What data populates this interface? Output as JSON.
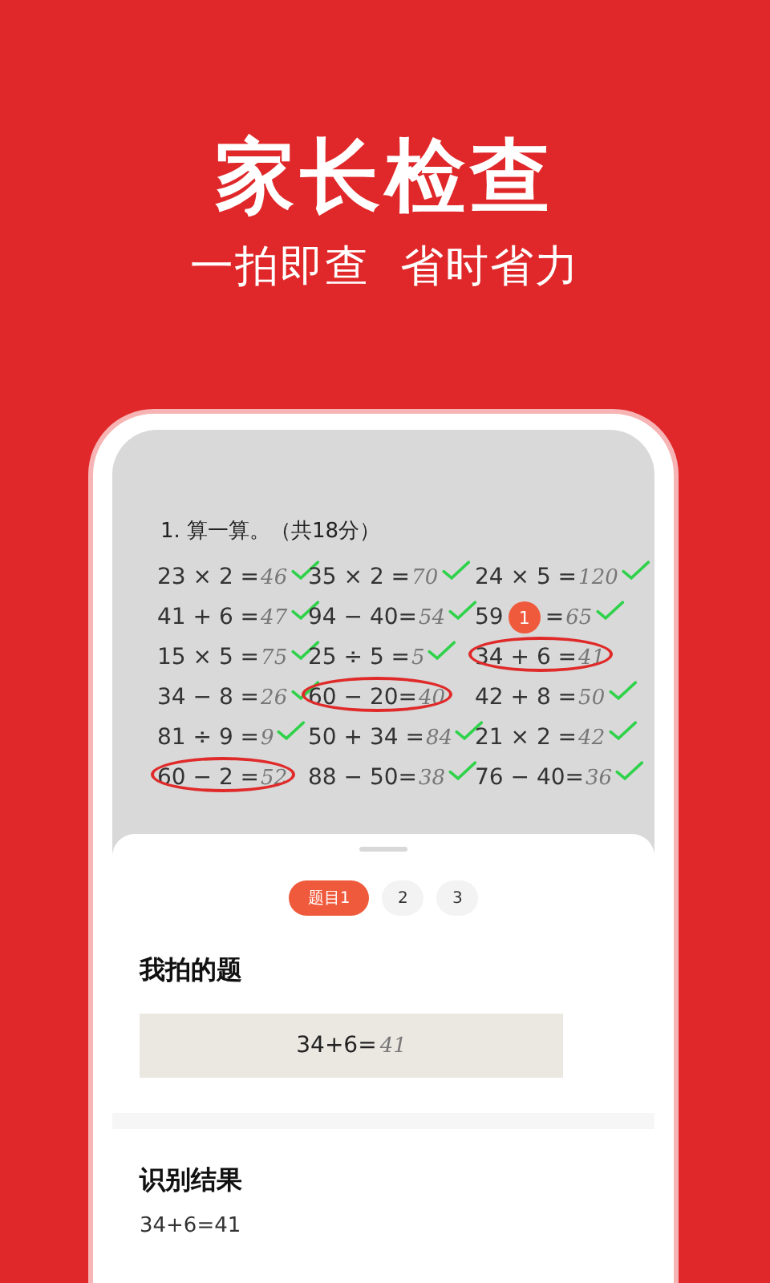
{
  "headline": "家长检查",
  "tagline": "一拍即查  省时省力",
  "worksheet": {
    "title": "1. 算一算。（共18分）",
    "items": [
      {
        "expr": "23 × 2 =",
        "answer": "46",
        "correct": true
      },
      {
        "expr": "35 × 2 =",
        "answer": "70",
        "correct": true
      },
      {
        "expr": "24 × 5 =",
        "answer": "120",
        "correct": true
      },
      {
        "expr": "41 + 6 =",
        "answer": "47",
        "correct": true
      },
      {
        "expr": "94 − 40=",
        "answer": "54",
        "correct": true
      },
      {
        "expr": "59",
        "expr_after": "=",
        "marker": "1",
        "answer": "65",
        "correct": true
      },
      {
        "expr": "15 × 5 =",
        "answer": "75",
        "correct": true
      },
      {
        "expr": "25 ÷ 5 =",
        "answer": "5",
        "correct": true
      },
      {
        "expr": "34 + 6 =",
        "answer": "41",
        "correct": false
      },
      {
        "expr": "34 − 8 =",
        "answer": "26",
        "correct": true
      },
      {
        "expr": "60 − 20=",
        "answer": "40",
        "correct": false
      },
      {
        "expr": "42 + 8 =",
        "answer": "50",
        "correct": true
      },
      {
        "expr": "81 ÷ 9 =",
        "answer": "9",
        "correct": true
      },
      {
        "expr": "50 + 34 =",
        "answer": "84",
        "correct": true
      },
      {
        "expr": "21 × 2 =",
        "answer": "42",
        "correct": true
      },
      {
        "expr": "60 − 2 =",
        "answer": "52",
        "correct": false
      },
      {
        "expr": "88 − 50=",
        "answer": "38",
        "correct": true
      },
      {
        "expr": "76 − 40=",
        "answer": "36",
        "correct": true
      }
    ]
  },
  "question_tabs": [
    {
      "label": "题目1",
      "selected": true
    },
    {
      "label": "2",
      "selected": false
    },
    {
      "label": "3",
      "selected": false
    }
  ],
  "photo_section": {
    "title": "我拍的题",
    "expr": "34+6=",
    "answer": "41"
  },
  "result_section": {
    "title": "识别结果",
    "text": "34+6=41"
  }
}
